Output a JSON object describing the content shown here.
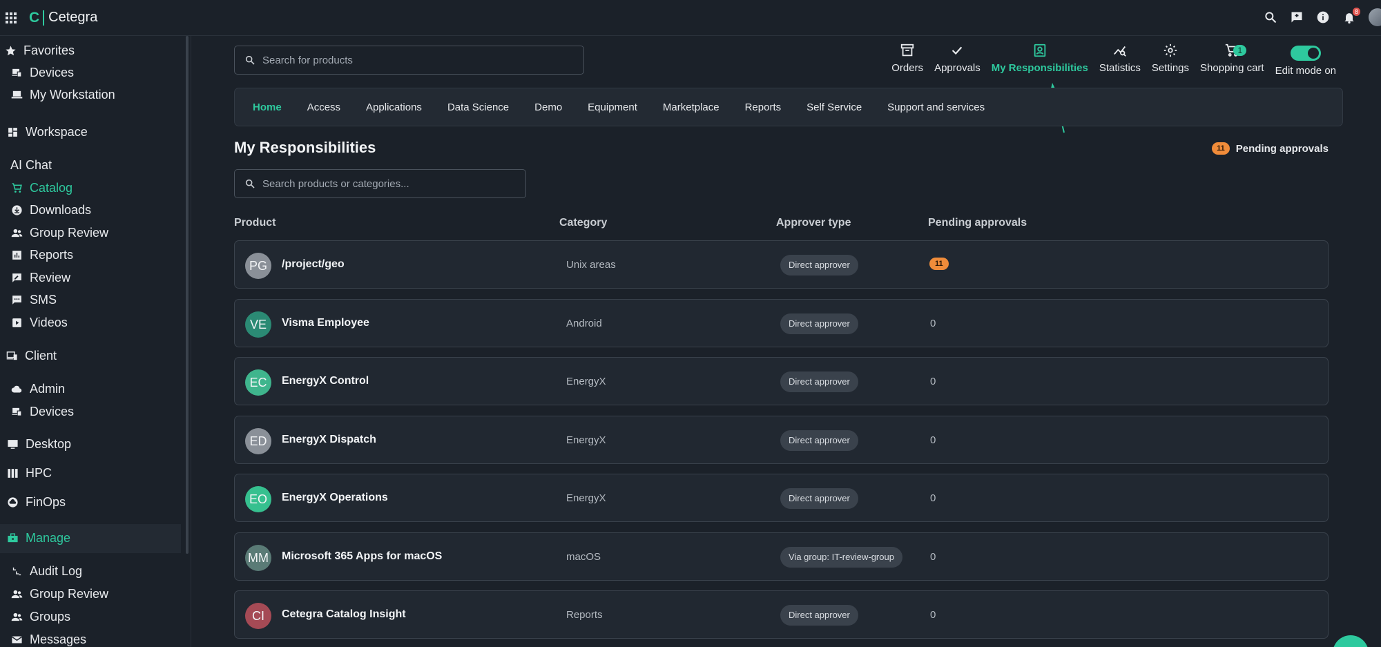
{
  "app": {
    "logo_mark": "C",
    "name": "Cetegra"
  },
  "topbar": {
    "notification_count": "8"
  },
  "sidebar": {
    "favorites": "Favorites",
    "fav_items": [
      "Devices",
      "My Workstation"
    ],
    "workspace": "Workspace",
    "workspace_items": [
      "AI Chat",
      "Catalog",
      "Downloads",
      "Group Review",
      "Reports",
      "Review",
      "SMS",
      "Videos"
    ],
    "client": "Client",
    "client_items": [
      "Admin",
      "Devices"
    ],
    "desktop": "Desktop",
    "hpc": "HPC",
    "finops": "FinOps",
    "manage": "Manage",
    "manage_items": [
      "Audit Log",
      "Group Review",
      "Groups",
      "Messages"
    ]
  },
  "search_top": {
    "placeholder": "Search for products"
  },
  "toolbar": {
    "orders": "Orders",
    "approvals": "Approvals",
    "my_responsibilities": "My Responsibilities",
    "statistics": "Statistics",
    "settings": "Settings",
    "shopping_cart": "Shopping cart",
    "cart_count": "1",
    "edit_mode": "Edit mode on"
  },
  "nav_tabs": [
    "Home",
    "Access",
    "Applications",
    "Data Science",
    "Demo",
    "Equipment",
    "Marketplace",
    "Reports",
    "Self Service",
    "Support and services"
  ],
  "page": {
    "title": "My Responsibilities",
    "pending_count": "11",
    "pending_label": "Pending approvals",
    "search_placeholder": "Search products or categories..."
  },
  "table": {
    "headers": [
      "Product",
      "Category",
      "Approver type",
      "Pending approvals"
    ],
    "rows": [
      {
        "initials": "PG",
        "name": "/project/geo",
        "category": "Unix areas",
        "approver": "Direct approver",
        "pending": "11",
        "avatar_color": "#8a9098"
      },
      {
        "initials": "VE",
        "name": "Visma Employee",
        "category": "Android",
        "approver": "Direct approver",
        "pending": "0",
        "avatar_color": "#2b8a74"
      },
      {
        "initials": "EC",
        "name": "EnergyX Control",
        "category": "EnergyX",
        "approver": "Direct approver",
        "pending": "0",
        "avatar_color": "#3fb58d"
      },
      {
        "initials": "ED",
        "name": "EnergyX Dispatch",
        "category": "EnergyX",
        "approver": "Direct approver",
        "pending": "0",
        "avatar_color": "#8a9098"
      },
      {
        "initials": "EO",
        "name": "EnergyX Operations",
        "category": "EnergyX",
        "approver": "Direct approver",
        "pending": "0",
        "avatar_color": "#36c08f"
      },
      {
        "initials": "MM",
        "name": "Microsoft 365 Apps for macOS",
        "category": "macOS",
        "approver": "Via group: IT-review-group",
        "pending": "0",
        "avatar_color": "#5a7b76"
      },
      {
        "initials": "CI",
        "name": "Cetegra Catalog Insight",
        "category": "Reports",
        "approver": "Direct approver",
        "pending": "0",
        "avatar_color": "#a54a55"
      }
    ]
  },
  "colors": {
    "accent": "#2ec99e",
    "badge": "#f08c3a",
    "background": "#1b2129"
  }
}
